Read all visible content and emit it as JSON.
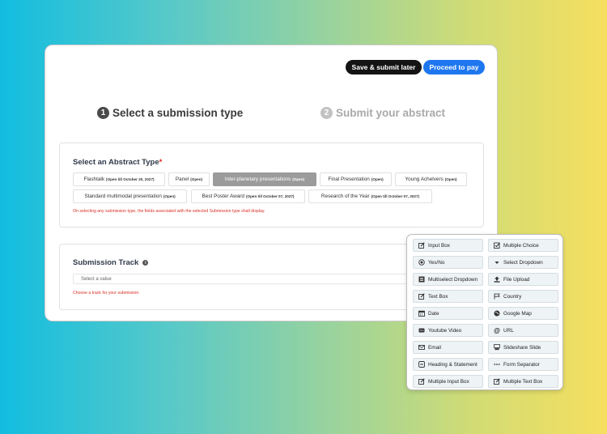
{
  "toolbar": {
    "save_label": "Save & submit later",
    "pay_label": "Proceed to pay"
  },
  "steps": [
    {
      "num": "1",
      "label": "Select a submission type"
    },
    {
      "num": "2",
      "label": "Submit your abstract"
    }
  ],
  "abstract_section": {
    "title": "Select an Abstract Type",
    "required_mark": "*",
    "types": [
      {
        "label": "Flashtalk",
        "note": "(Open till October 20, 2027)"
      },
      {
        "label": "Panel",
        "note": "(Open)"
      },
      {
        "label": "Inter-planetary presentations",
        "note": "(Open)"
      },
      {
        "label": "Final Presentation",
        "note": "(Open)"
      },
      {
        "label": "Young Achelvers",
        "note": "(Open)"
      },
      {
        "label": "Standard multimodal presentation",
        "note": "(Open)"
      },
      {
        "label": "Best Poster Award",
        "note": "(Open till October 07, 2027)"
      },
      {
        "label": "Research of the Year",
        "note": "(Open till October 07, 2027)"
      }
    ],
    "selected_index": 2,
    "hint": "On selecting any submission type, the fields associated with the selected Submission type shall display."
  },
  "track_section": {
    "title": "Submission Track",
    "info_glyph": "i",
    "placeholder": "Select a value",
    "hint": "Choose a track for your submission."
  },
  "field_panel": {
    "items": [
      {
        "label": "Input Box",
        "icon": "edit-icon"
      },
      {
        "label": "Multiple Choice",
        "icon": "checkbox-icon"
      },
      {
        "label": "Yes/No",
        "icon": "radio-icon"
      },
      {
        "label": "Select Dropdown",
        "icon": "caret-down-icon"
      },
      {
        "label": "Multiselect Dropdown",
        "icon": "list-icon"
      },
      {
        "label": "File Upload",
        "icon": "upload-icon"
      },
      {
        "label": "Text Box",
        "icon": "edit-icon"
      },
      {
        "label": "Country",
        "icon": "flag-icon"
      },
      {
        "label": "Date",
        "icon": "calendar-icon"
      },
      {
        "label": "Google Map",
        "icon": "globe-icon"
      },
      {
        "label": "Youtube Video",
        "icon": "video-icon"
      },
      {
        "label": "URL",
        "icon": "at-icon"
      },
      {
        "label": "Email",
        "icon": "mail-icon"
      },
      {
        "label": "Slideshare Slide",
        "icon": "slides-icon"
      },
      {
        "label": "Heading & Statement",
        "icon": "minus-box-icon"
      },
      {
        "label": "Form Separator",
        "icon": "dots-icon"
      },
      {
        "label": "Multiple Input Box",
        "icon": "edit-icon"
      },
      {
        "label": "Multiple Text Box",
        "icon": "edit-icon"
      }
    ]
  },
  "colors": {
    "accent": "#1f77f0",
    "dark_button": "#141414",
    "error": "#d93025",
    "selected_chip": "#9b9b9b"
  }
}
